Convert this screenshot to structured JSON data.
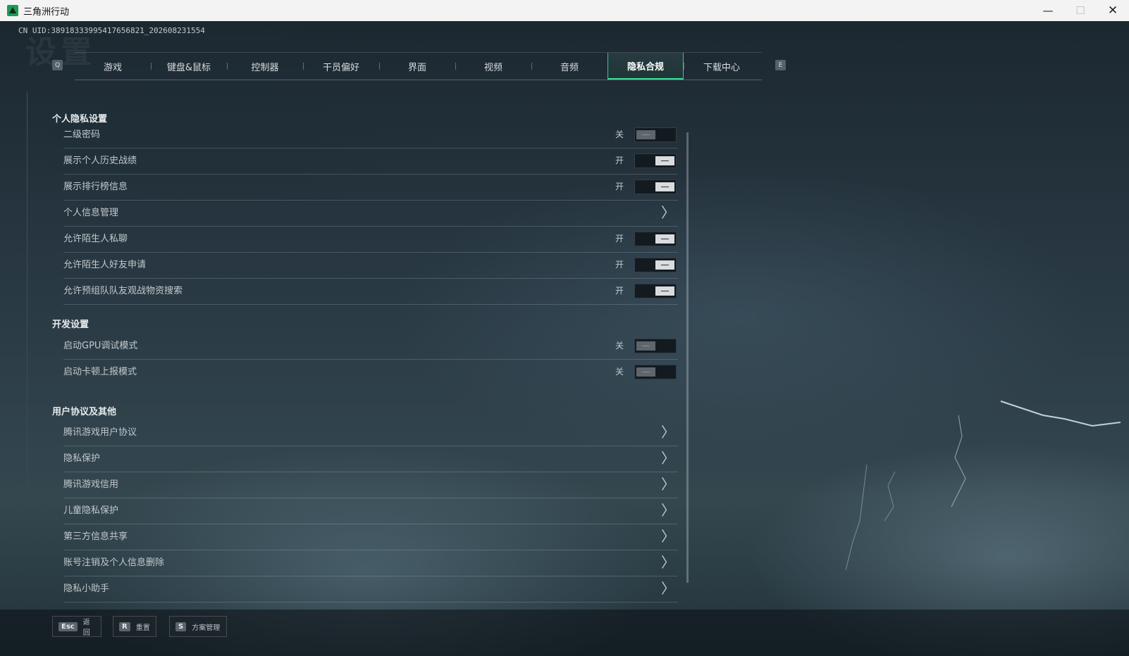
{
  "window": {
    "title": "三角洲行动",
    "min_glyph": "—",
    "max_glyph": "☐",
    "close_glyph": "✕"
  },
  "uid": "CN UID:38918333995417656821_202608231554",
  "watermark": "设置",
  "tabs": {
    "prev_key": "Q",
    "next_key": "E",
    "items": [
      {
        "label": "游戏"
      },
      {
        "label": "键盘&鼠标"
      },
      {
        "label": "控制器"
      },
      {
        "label": "干员偏好"
      },
      {
        "label": "界面"
      },
      {
        "label": "视频"
      },
      {
        "label": "音频"
      },
      {
        "label": "隐私合规"
      },
      {
        "label": "下载中心"
      }
    ],
    "active": "隐私合规"
  },
  "sections": {
    "privacy": {
      "title": "个人隐私设置",
      "rows": [
        {
          "label": "二级密码",
          "state": "关",
          "on": false
        },
        {
          "label": "展示个人历史战绩",
          "state": "开",
          "on": true
        },
        {
          "label": "展示排行榜信息",
          "state": "开",
          "on": true
        },
        {
          "label": "个人信息管理",
          "chevron": "〉"
        },
        {
          "label": "允许陌生人私聊",
          "state": "开",
          "on": true
        },
        {
          "label": "允许陌生人好友申请",
          "state": "开",
          "on": true
        },
        {
          "label": "允许预组队队友观战物资搜索",
          "state": "开",
          "on": true
        }
      ]
    },
    "dev": {
      "title": "开发设置",
      "rows": [
        {
          "label": "启动GPU调试模式",
          "state": "关",
          "on": false
        },
        {
          "label": "启动卡顿上报模式",
          "state": "关",
          "on": false
        }
      ]
    },
    "agreements": {
      "title": "用户协议及其他",
      "rows": [
        {
          "label": "腾讯游戏用户协议",
          "chevron": "〉"
        },
        {
          "label": "隐私保护",
          "chevron": "〉"
        },
        {
          "label": "腾讯游戏信用",
          "chevron": "〉"
        },
        {
          "label": "儿童隐私保护",
          "chevron": "〉"
        },
        {
          "label": "第三方信息共享",
          "chevron": "〉"
        },
        {
          "label": "账号注销及个人信息删除",
          "chevron": "〉"
        },
        {
          "label": "隐私小助手",
          "chevron": "〉"
        }
      ]
    }
  },
  "bottom": {
    "back": {
      "key": "Esc",
      "label": "返回"
    },
    "reset": {
      "key": "R",
      "label": "重置"
    },
    "scheme": {
      "key": "S",
      "label": "方案管理"
    }
  },
  "colors": {
    "accent": "#3fdc9a",
    "toggle_on": "#d9dcde",
    "toggle_off": "#5e666c"
  }
}
